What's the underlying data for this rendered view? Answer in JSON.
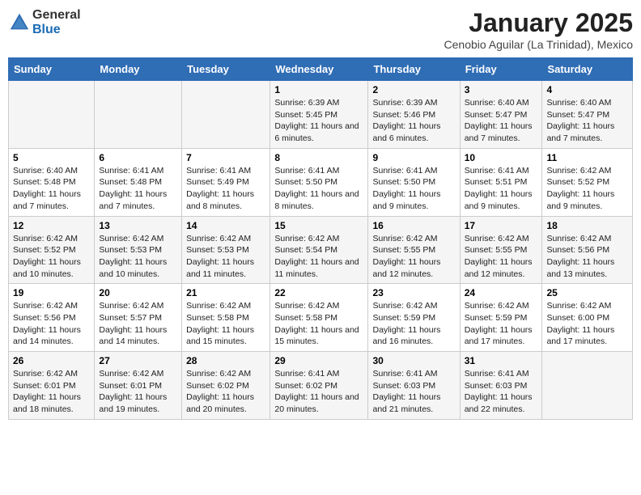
{
  "header": {
    "logo_general": "General",
    "logo_blue": "Blue",
    "title": "January 2025",
    "subtitle": "Cenobio Aguilar (La Trinidad), Mexico"
  },
  "weekdays": [
    "Sunday",
    "Monday",
    "Tuesday",
    "Wednesday",
    "Thursday",
    "Friday",
    "Saturday"
  ],
  "weeks": [
    [
      null,
      null,
      null,
      {
        "day": "1",
        "sunrise": "Sunrise: 6:39 AM",
        "sunset": "Sunset: 5:45 PM",
        "daylight": "Daylight: 11 hours and 6 minutes."
      },
      {
        "day": "2",
        "sunrise": "Sunrise: 6:39 AM",
        "sunset": "Sunset: 5:46 PM",
        "daylight": "Daylight: 11 hours and 6 minutes."
      },
      {
        "day": "3",
        "sunrise": "Sunrise: 6:40 AM",
        "sunset": "Sunset: 5:47 PM",
        "daylight": "Daylight: 11 hours and 7 minutes."
      },
      {
        "day": "4",
        "sunrise": "Sunrise: 6:40 AM",
        "sunset": "Sunset: 5:47 PM",
        "daylight": "Daylight: 11 hours and 7 minutes."
      }
    ],
    [
      {
        "day": "5",
        "sunrise": "Sunrise: 6:40 AM",
        "sunset": "Sunset: 5:48 PM",
        "daylight": "Daylight: 11 hours and 7 minutes."
      },
      {
        "day": "6",
        "sunrise": "Sunrise: 6:41 AM",
        "sunset": "Sunset: 5:48 PM",
        "daylight": "Daylight: 11 hours and 7 minutes."
      },
      {
        "day": "7",
        "sunrise": "Sunrise: 6:41 AM",
        "sunset": "Sunset: 5:49 PM",
        "daylight": "Daylight: 11 hours and 8 minutes."
      },
      {
        "day": "8",
        "sunrise": "Sunrise: 6:41 AM",
        "sunset": "Sunset: 5:50 PM",
        "daylight": "Daylight: 11 hours and 8 minutes."
      },
      {
        "day": "9",
        "sunrise": "Sunrise: 6:41 AM",
        "sunset": "Sunset: 5:50 PM",
        "daylight": "Daylight: 11 hours and 9 minutes."
      },
      {
        "day": "10",
        "sunrise": "Sunrise: 6:41 AM",
        "sunset": "Sunset: 5:51 PM",
        "daylight": "Daylight: 11 hours and 9 minutes."
      },
      {
        "day": "11",
        "sunrise": "Sunrise: 6:42 AM",
        "sunset": "Sunset: 5:52 PM",
        "daylight": "Daylight: 11 hours and 9 minutes."
      }
    ],
    [
      {
        "day": "12",
        "sunrise": "Sunrise: 6:42 AM",
        "sunset": "Sunset: 5:52 PM",
        "daylight": "Daylight: 11 hours and 10 minutes."
      },
      {
        "day": "13",
        "sunrise": "Sunrise: 6:42 AM",
        "sunset": "Sunset: 5:53 PM",
        "daylight": "Daylight: 11 hours and 10 minutes."
      },
      {
        "day": "14",
        "sunrise": "Sunrise: 6:42 AM",
        "sunset": "Sunset: 5:53 PM",
        "daylight": "Daylight: 11 hours and 11 minutes."
      },
      {
        "day": "15",
        "sunrise": "Sunrise: 6:42 AM",
        "sunset": "Sunset: 5:54 PM",
        "daylight": "Daylight: 11 hours and 11 minutes."
      },
      {
        "day": "16",
        "sunrise": "Sunrise: 6:42 AM",
        "sunset": "Sunset: 5:55 PM",
        "daylight": "Daylight: 11 hours and 12 minutes."
      },
      {
        "day": "17",
        "sunrise": "Sunrise: 6:42 AM",
        "sunset": "Sunset: 5:55 PM",
        "daylight": "Daylight: 11 hours and 12 minutes."
      },
      {
        "day": "18",
        "sunrise": "Sunrise: 6:42 AM",
        "sunset": "Sunset: 5:56 PM",
        "daylight": "Daylight: 11 hours and 13 minutes."
      }
    ],
    [
      {
        "day": "19",
        "sunrise": "Sunrise: 6:42 AM",
        "sunset": "Sunset: 5:56 PM",
        "daylight": "Daylight: 11 hours and 14 minutes."
      },
      {
        "day": "20",
        "sunrise": "Sunrise: 6:42 AM",
        "sunset": "Sunset: 5:57 PM",
        "daylight": "Daylight: 11 hours and 14 minutes."
      },
      {
        "day": "21",
        "sunrise": "Sunrise: 6:42 AM",
        "sunset": "Sunset: 5:58 PM",
        "daylight": "Daylight: 11 hours and 15 minutes."
      },
      {
        "day": "22",
        "sunrise": "Sunrise: 6:42 AM",
        "sunset": "Sunset: 5:58 PM",
        "daylight": "Daylight: 11 hours and 15 minutes."
      },
      {
        "day": "23",
        "sunrise": "Sunrise: 6:42 AM",
        "sunset": "Sunset: 5:59 PM",
        "daylight": "Daylight: 11 hours and 16 minutes."
      },
      {
        "day": "24",
        "sunrise": "Sunrise: 6:42 AM",
        "sunset": "Sunset: 5:59 PM",
        "daylight": "Daylight: 11 hours and 17 minutes."
      },
      {
        "day": "25",
        "sunrise": "Sunrise: 6:42 AM",
        "sunset": "Sunset: 6:00 PM",
        "daylight": "Daylight: 11 hours and 17 minutes."
      }
    ],
    [
      {
        "day": "26",
        "sunrise": "Sunrise: 6:42 AM",
        "sunset": "Sunset: 6:01 PM",
        "daylight": "Daylight: 11 hours and 18 minutes."
      },
      {
        "day": "27",
        "sunrise": "Sunrise: 6:42 AM",
        "sunset": "Sunset: 6:01 PM",
        "daylight": "Daylight: 11 hours and 19 minutes."
      },
      {
        "day": "28",
        "sunrise": "Sunrise: 6:42 AM",
        "sunset": "Sunset: 6:02 PM",
        "daylight": "Daylight: 11 hours and 20 minutes."
      },
      {
        "day": "29",
        "sunrise": "Sunrise: 6:41 AM",
        "sunset": "Sunset: 6:02 PM",
        "daylight": "Daylight: 11 hours and 20 minutes."
      },
      {
        "day": "30",
        "sunrise": "Sunrise: 6:41 AM",
        "sunset": "Sunset: 6:03 PM",
        "daylight": "Daylight: 11 hours and 21 minutes."
      },
      {
        "day": "31",
        "sunrise": "Sunrise: 6:41 AM",
        "sunset": "Sunset: 6:03 PM",
        "daylight": "Daylight: 11 hours and 22 minutes."
      },
      null
    ]
  ]
}
